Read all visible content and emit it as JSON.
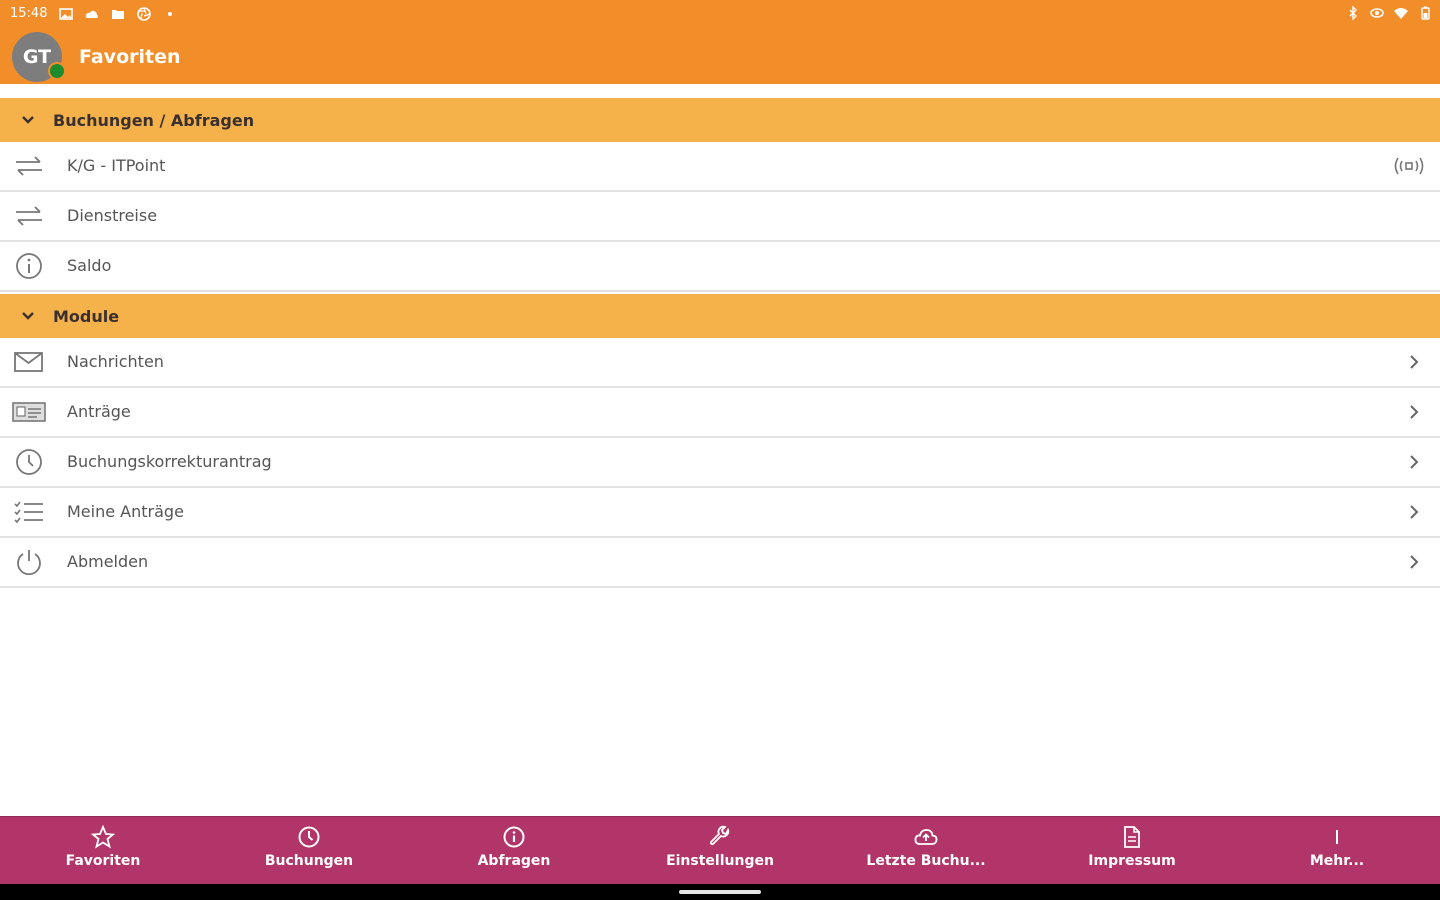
{
  "status_bar": {
    "time": "15:48",
    "left_icons": [
      "image-icon",
      "cloud-icon",
      "folder-icon",
      "aperture-icon",
      "dot-icon"
    ],
    "right_icons": [
      "bluetooth-icon",
      "eye-icon",
      "wifi-icon",
      "battery-icon"
    ]
  },
  "app_bar": {
    "avatar_initials": "GT",
    "title": "Favoriten",
    "online_color": "#1d8c2e",
    "bar_color": "#f28e2a"
  },
  "sections": [
    {
      "title": "Buchungen / Abfragen",
      "items": [
        {
          "label": "K/G - ITPoint",
          "icon": "swap-arrows-icon",
          "trailing": "nfc-icon"
        },
        {
          "label": "Dienstreise",
          "icon": "swap-arrows-icon",
          "trailing": ""
        },
        {
          "label": "Saldo",
          "icon": "info-icon",
          "trailing": ""
        }
      ]
    },
    {
      "title": "Module",
      "items": [
        {
          "label": "Nachrichten",
          "icon": "mail-icon",
          "trailing": "chevron-right-icon"
        },
        {
          "label": "Anträge",
          "icon": "id-card-icon",
          "trailing": "chevron-right-icon"
        },
        {
          "label": "Buchungskorrekturantrag",
          "icon": "clock-icon",
          "trailing": "chevron-right-icon"
        },
        {
          "label": "Meine Anträge",
          "icon": "checklist-icon",
          "trailing": "chevron-right-icon"
        },
        {
          "label": "Abmelden",
          "icon": "power-icon",
          "trailing": "chevron-right-icon"
        }
      ]
    }
  ],
  "bottom_nav": {
    "color": "#b13568",
    "items": [
      {
        "label": "Favoriten",
        "icon": "star-icon"
      },
      {
        "label": "Buchungen",
        "icon": "clock-icon"
      },
      {
        "label": "Abfragen",
        "icon": "info-icon"
      },
      {
        "label": "Einstellungen",
        "icon": "wrench-icon"
      },
      {
        "label": "Letzte Buchu...",
        "icon": "cloud-upload-icon"
      },
      {
        "label": "Impressum",
        "icon": "document-icon"
      },
      {
        "label": "Mehr...",
        "icon": "more-vertical-icon"
      }
    ]
  },
  "colors": {
    "section_header": "#f6b24a",
    "row_divider": "#e2e2e2"
  }
}
